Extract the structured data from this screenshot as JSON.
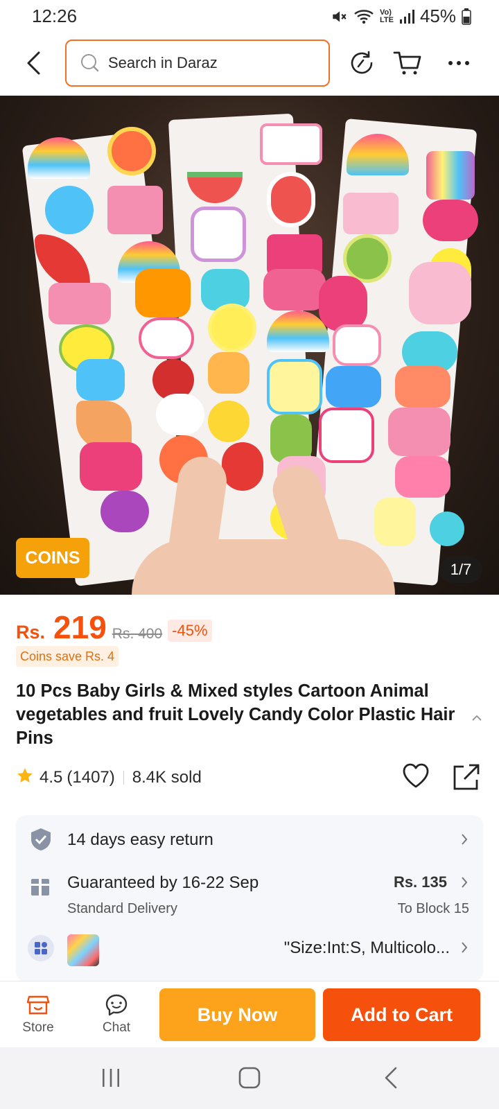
{
  "status_bar": {
    "time": "12:26",
    "battery": "45%",
    "icons": [
      "mute-icon",
      "wifi-icon",
      "volte-icon",
      "signal-icon",
      "battery-icon"
    ]
  },
  "header": {
    "search_placeholder": "Search in Daraz",
    "icons": [
      "back-icon",
      "search-icon",
      "history-icon",
      "cart-icon",
      "more-icon"
    ]
  },
  "gallery": {
    "coins_badge": "COINS",
    "counter": "1/7"
  },
  "price": {
    "currency": "Rs.",
    "current": "219",
    "original": "Rs. 400",
    "discount": "-45%",
    "coins_save": "Coins save Rs. 4"
  },
  "product": {
    "title": "10 Pcs Baby Girls & Mixed styles Cartoon Animal vegetables and fruit Lovely Candy Color Plastic Hair Pins",
    "rating": "4.5",
    "reviews": "(1407)",
    "sold": "8.4K sold"
  },
  "info": {
    "return": "14 days easy return",
    "delivery_title": "Guaranteed by 16-22 Sep",
    "delivery_sub": "Standard Delivery",
    "delivery_price": "Rs. 135",
    "delivery_to": "To Block 15",
    "variant": "\"Size:Int:S, Multicolo..."
  },
  "bottom_bar": {
    "store": "Store",
    "chat": "Chat",
    "buy_now": "Buy Now",
    "add_to_cart": "Add to Cart"
  },
  "colors": {
    "brand_orange": "#f5510d",
    "buy_now": "#fca31b",
    "coins": "#f5a20a",
    "search_border": "#f36f24"
  }
}
